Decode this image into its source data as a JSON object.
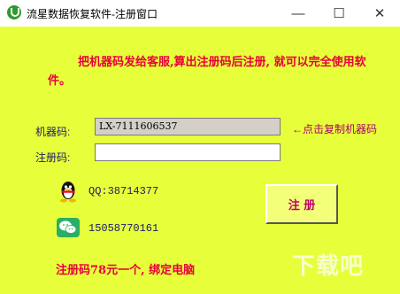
{
  "window": {
    "title": "流星数据恢复软件-注册窗口",
    "controls": {
      "minimize": "—",
      "maximize": "☐",
      "close": "✕"
    }
  },
  "notice": "把机器码发给客服,算出注册码后注册, 就可以完全使用软件。",
  "machine_code": {
    "label": "机器码:",
    "value": "LX-7111606537",
    "copy_hint": "←点击复制机器码"
  },
  "register_code": {
    "label": "注册码:",
    "value": ""
  },
  "contacts": {
    "qq": "QQ:38714377",
    "phone": "15058770161"
  },
  "register_button": "注 册",
  "price_note": "注册码78元一个, 绑定电脑",
  "watermark": "下载吧",
  "colors": {
    "background": "#e6ff3a",
    "notice_text": "#e8003a",
    "label_text": "#1a1a6b",
    "accent_text": "#c0006a"
  },
  "icons": [
    "app-icon",
    "qq-icon",
    "wechat-icon"
  ]
}
